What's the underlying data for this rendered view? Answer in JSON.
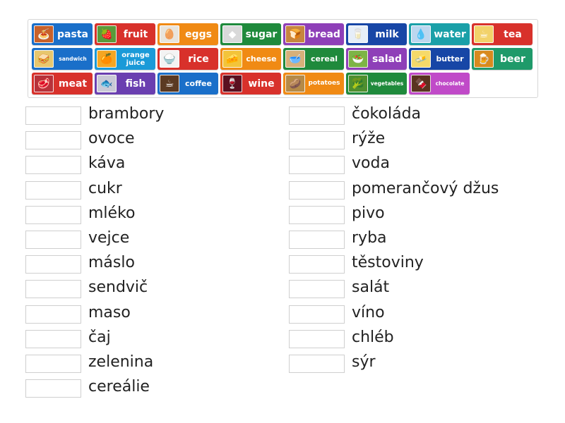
{
  "tiles": [
    {
      "label": "pasta",
      "color": "#1a6fc9",
      "icon": "pasta-icon",
      "glyph": "🍝",
      "thumb": "#c8612a"
    },
    {
      "label": "fruit",
      "color": "#d8312b",
      "icon": "fruit-icon",
      "glyph": "🍓",
      "thumb": "#5a9a3a"
    },
    {
      "label": "eggs",
      "color": "#f08a14",
      "icon": "eggs-icon",
      "glyph": "🥚",
      "thumb": "#e8e4dc"
    },
    {
      "label": "sugar",
      "color": "#1f8a3c",
      "icon": "sugar-icon",
      "glyph": "◆",
      "thumb": "#d9d9d9"
    },
    {
      "label": "bread",
      "color": "#8e3fb8",
      "icon": "bread-icon",
      "glyph": "🍞",
      "thumb": "#c7863f"
    },
    {
      "label": "milk",
      "color": "#1746a6",
      "icon": "milk-icon",
      "glyph": "🥛",
      "thumb": "#e6eef8"
    },
    {
      "label": "water",
      "color": "#1aa0a8",
      "icon": "water-icon",
      "glyph": "💧",
      "thumb": "#bcd7ef"
    },
    {
      "label": "tea",
      "color": "#d8312b",
      "icon": "tea-icon",
      "glyph": "☕",
      "thumb": "#f2d26a"
    },
    {
      "label": "sandwich",
      "color": "#1a6fc9",
      "icon": "sandwich-icon",
      "glyph": "🥪",
      "thumb": "#e7c76e"
    },
    {
      "label": "orange juice",
      "color": "#1a9ad8",
      "icon": "orange-juice-icon",
      "glyph": "🍊",
      "thumb": "#f5a623"
    },
    {
      "label": "rice",
      "color": "#d8312b",
      "icon": "rice-icon",
      "glyph": "🍚",
      "thumb": "#f3f3f3"
    },
    {
      "label": "cheese",
      "color": "#f08a14",
      "icon": "cheese-icon",
      "glyph": "🧀",
      "thumb": "#f3c43a"
    },
    {
      "label": "cereal",
      "color": "#1f8a3c",
      "icon": "cereal-icon",
      "glyph": "🥣",
      "thumb": "#d7b07a"
    },
    {
      "label": "salad",
      "color": "#8e3fb8",
      "icon": "salad-icon",
      "glyph": "🥗",
      "thumb": "#7db446"
    },
    {
      "label": "butter",
      "color": "#1746a6",
      "icon": "butter-icon",
      "glyph": "🧈",
      "thumb": "#f5d96a"
    },
    {
      "label": "beer",
      "color": "#1f9a6a",
      "icon": "beer-icon",
      "glyph": "🍺",
      "thumb": "#d88a1e"
    },
    {
      "label": "meat",
      "color": "#d8312b",
      "icon": "meat-icon",
      "glyph": "🥩",
      "thumb": "#b8323a"
    },
    {
      "label": "fish",
      "color": "#6a3fb0",
      "icon": "fish-icon",
      "glyph": "🐟",
      "thumb": "#c9c9d6"
    },
    {
      "label": "coffee",
      "color": "#1a6fc9",
      "icon": "coffee-icon",
      "glyph": "☕",
      "thumb": "#5b3a22"
    },
    {
      "label": "wine",
      "color": "#d8312b",
      "icon": "wine-icon",
      "glyph": "🍷",
      "thumb": "#5a1020"
    },
    {
      "label": "potatoes",
      "color": "#f08a14",
      "icon": "potatoes-icon",
      "glyph": "🥔",
      "thumb": "#b58a48"
    },
    {
      "label": "vegetables",
      "color": "#1f8a3c",
      "icon": "vegetables-icon",
      "glyph": "🥦",
      "thumb": "#4f8f2f"
    },
    {
      "label": "chocolate",
      "color": "#c04ac8",
      "icon": "chocolate-icon",
      "glyph": "🍫",
      "thumb": "#5a3420"
    }
  ],
  "left_words": [
    "brambory",
    "ovoce",
    "káva",
    "cukr",
    "mléko",
    "vejce",
    "máslo",
    "sendvič",
    "maso",
    "čaj",
    "zelenina",
    "cereálie"
  ],
  "right_words": [
    "čokoláda",
    "rýže",
    "voda",
    "pomerančový džus",
    "pivo",
    "ryba",
    "těstoviny",
    "salát",
    "víno",
    "chléb",
    "sýr"
  ]
}
